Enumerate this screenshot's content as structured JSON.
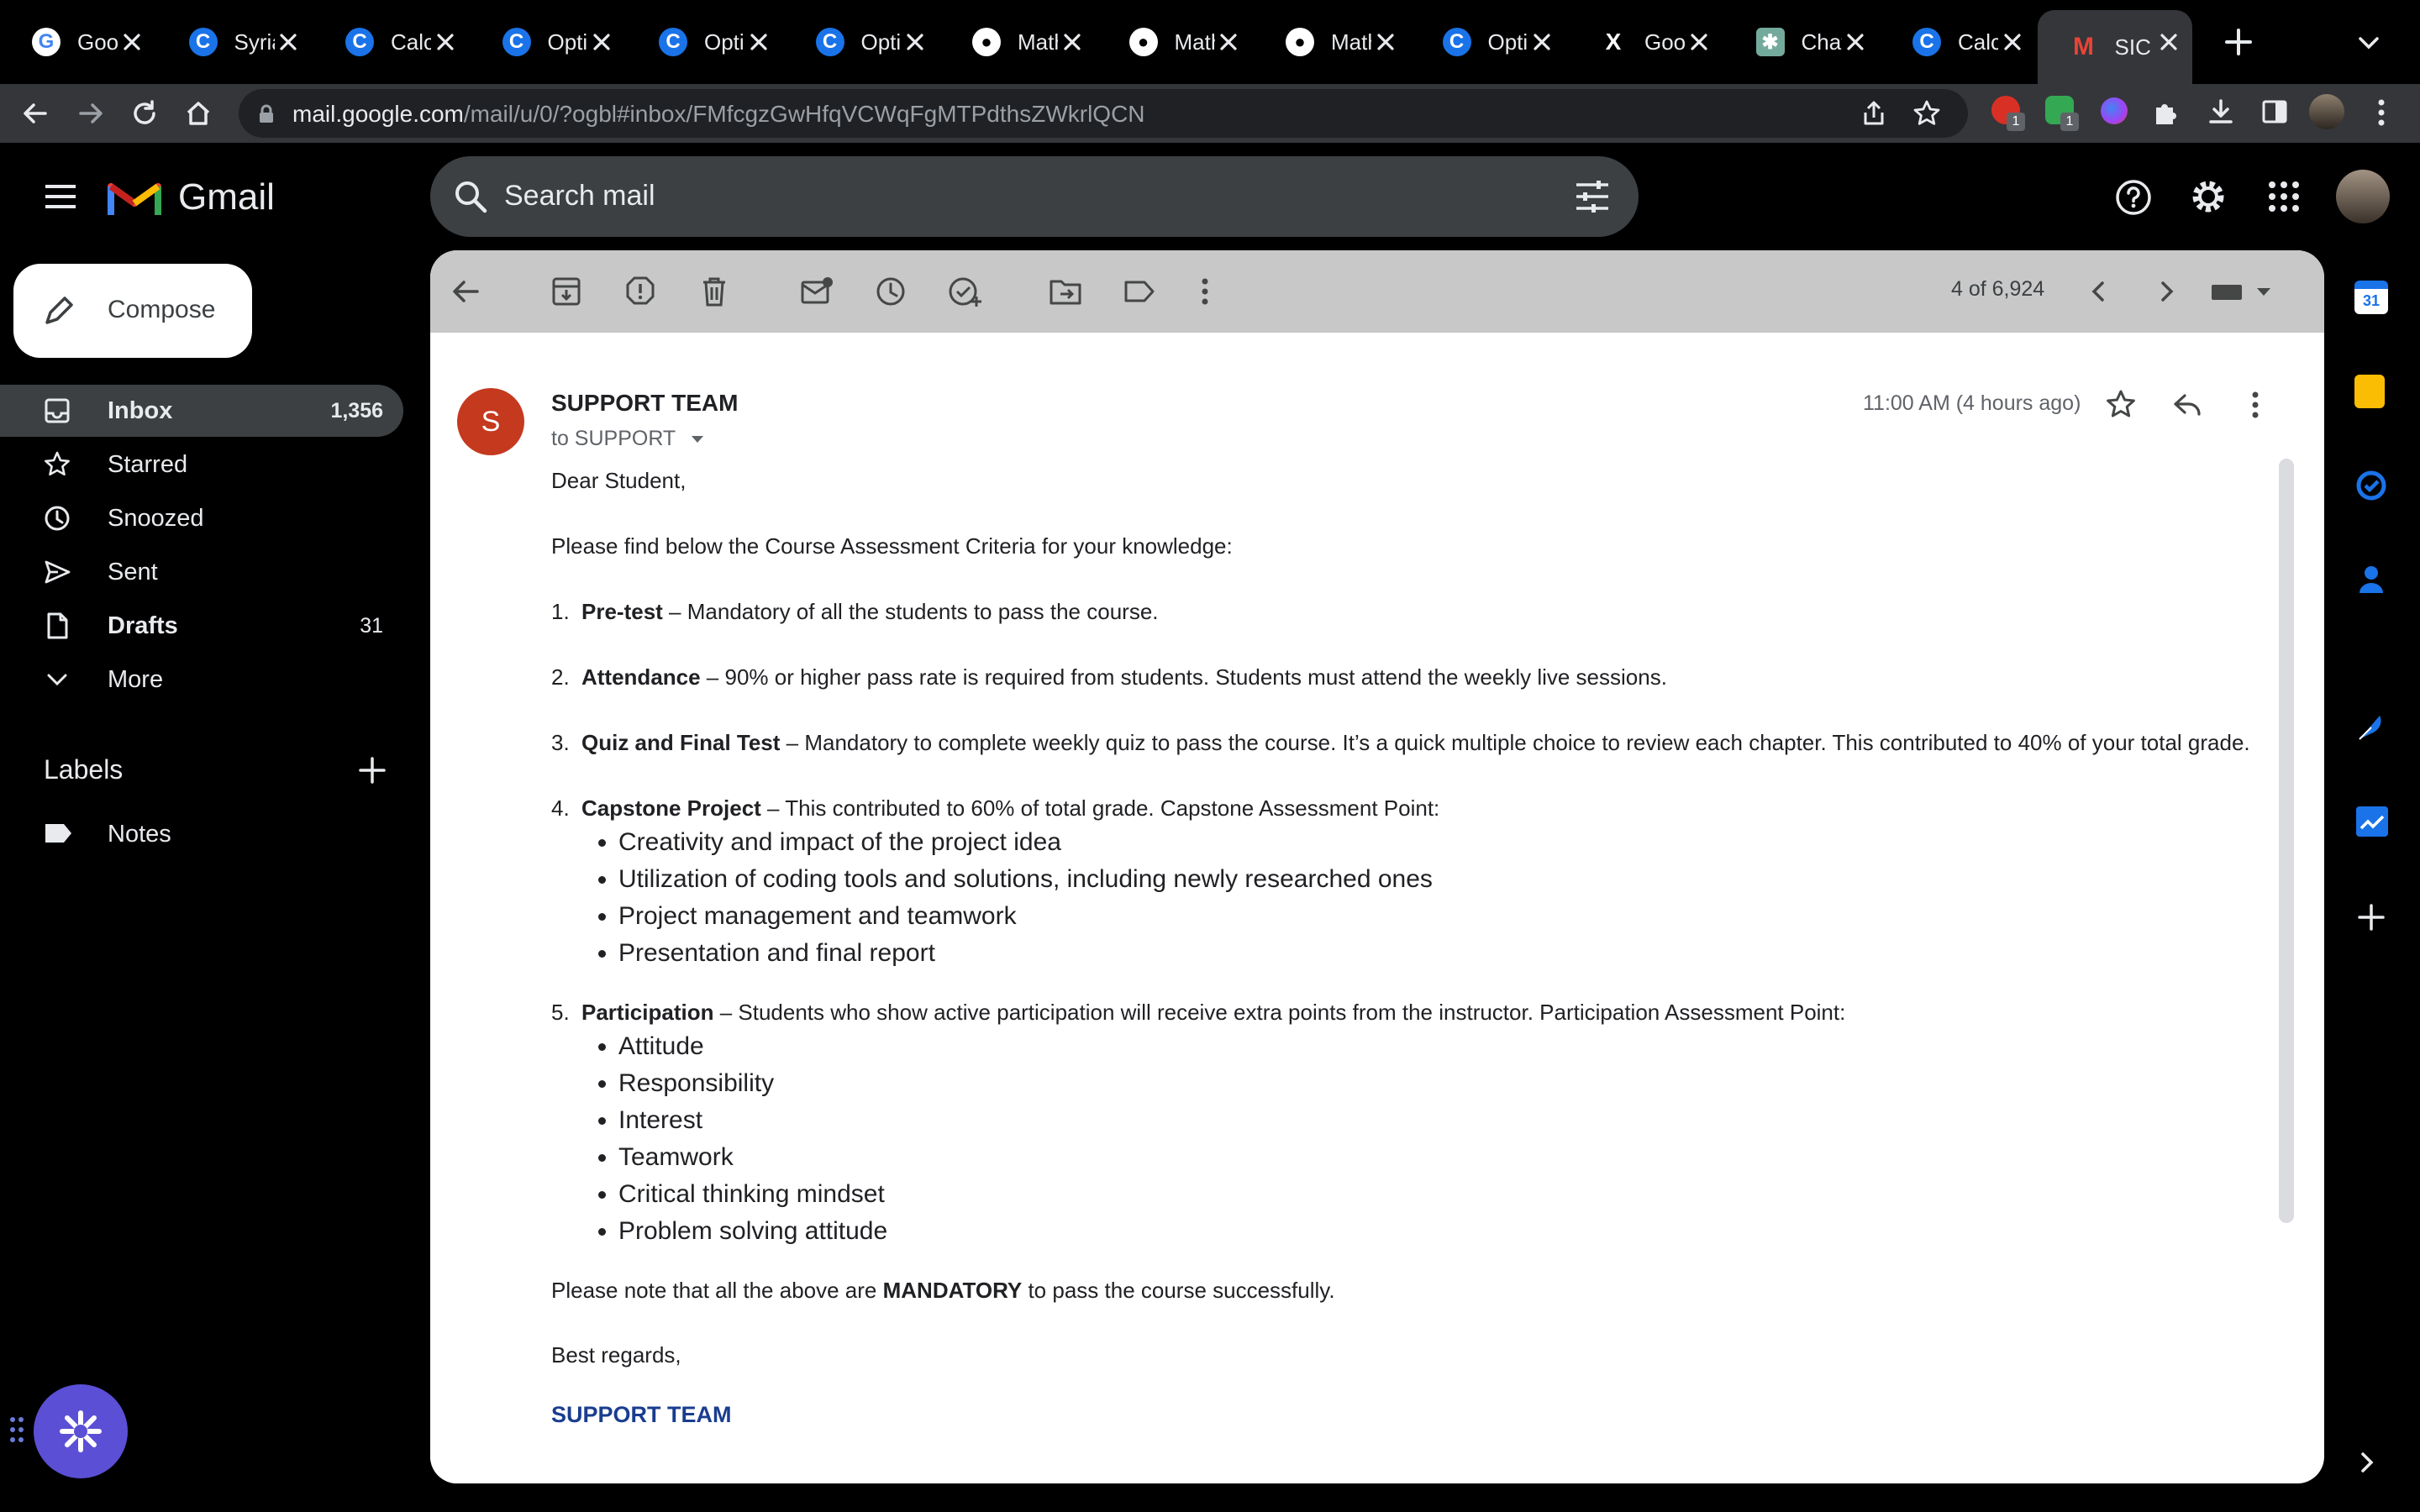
{
  "browser": {
    "tabs": [
      {
        "title": "Goo",
        "icon": "google-icon"
      },
      {
        "title": "Syria",
        "icon": "c-logo-icon"
      },
      {
        "title": "Calc",
        "icon": "c-logo-icon"
      },
      {
        "title": "Opti",
        "icon": "c-logo-icon"
      },
      {
        "title": "Opti",
        "icon": "c-logo-icon"
      },
      {
        "title": "Opti",
        "icon": "c-logo-icon"
      },
      {
        "title": "Math",
        "icon": "github-icon"
      },
      {
        "title": "Math",
        "icon": "github-icon"
      },
      {
        "title": "Math",
        "icon": "github-icon"
      },
      {
        "title": "Opti",
        "icon": "c-logo-icon"
      },
      {
        "title": "Goo",
        "icon": "x-logo-icon"
      },
      {
        "title": "Chat",
        "icon": "chatgpt-icon"
      },
      {
        "title": "Calc",
        "icon": "c-logo-icon"
      },
      {
        "title": "SIC",
        "icon": "gmail-icon",
        "active": true
      }
    ],
    "url_host": "mail.google.com",
    "url_path": "/mail/u/0/?ogbl#inbox/FMfcgzGwHfqVCWqFgMTPdthsZWkrlQCN",
    "extension_badges": [
      "1",
      "1"
    ]
  },
  "gmail": {
    "brand": "Gmail",
    "search_placeholder": "Search mail",
    "compose_label": "Compose",
    "nav": [
      {
        "label": "Inbox",
        "count": "1,356"
      },
      {
        "label": "Starred",
        "count": ""
      },
      {
        "label": "Snoozed",
        "count": ""
      },
      {
        "label": "Sent",
        "count": ""
      },
      {
        "label": "Drafts",
        "count": "31"
      },
      {
        "label": "More",
        "count": ""
      }
    ],
    "labels_title": "Labels",
    "labels": [
      {
        "label": "Notes"
      }
    ],
    "pager": "4 of 6,924"
  },
  "message": {
    "avatar_letter": "S",
    "sender": "SUPPORT TEAM",
    "to": "to SUPPORT",
    "date": "11:00 AM (4 hours ago)",
    "greeting": "Dear Student,",
    "intro": "Please find below the Course Assessment Criteria for your knowledge:",
    "items": [
      {
        "num": "1.",
        "title": "Pre-test",
        "text": " – Mandatory of all the students to pass the course.",
        "bullets": []
      },
      {
        "num": "2.",
        "title": "Attendance",
        "text": " – 90% or higher pass rate is required from students. Students must attend the weekly live sessions.",
        "bullets": []
      },
      {
        "num": "3.",
        "title": "Quiz and Final Test",
        "text": " – Mandatory to complete weekly quiz to pass the course. It’s a quick multiple choice to review each chapter. This contributed to 40% of your total grade.",
        "bullets": []
      },
      {
        "num": "4.",
        "title": "Capstone Project",
        "text": " – This contributed to 60% of total grade. Capstone Assessment Point:",
        "bullets": [
          "Creativity and impact of the project idea",
          "Utilization of coding tools and solutions, including newly researched ones",
          "Project management and teamwork",
          "Presentation and final report"
        ]
      },
      {
        "num": "5.",
        "title": "Participation",
        "text": " – Students who show active participation will receive extra points from the instructor. Participation Assessment Point:",
        "bullets": [
          "Attitude",
          "Responsibility",
          "Interest",
          "Teamwork",
          "Critical thinking mindset",
          "Problem solving attitude"
        ]
      }
    ],
    "note_pre": "Please note that all the above are ",
    "note_bold": "MANDATORY",
    "note_post": " to pass the course successfully.",
    "closing": "Best regards,",
    "signature": "SUPPORT TEAM"
  },
  "colors": {
    "accent": "#1a73e8",
    "avatar": "#c5391f",
    "signature": "#1a3d8f",
    "fab": "#6a5acd"
  }
}
